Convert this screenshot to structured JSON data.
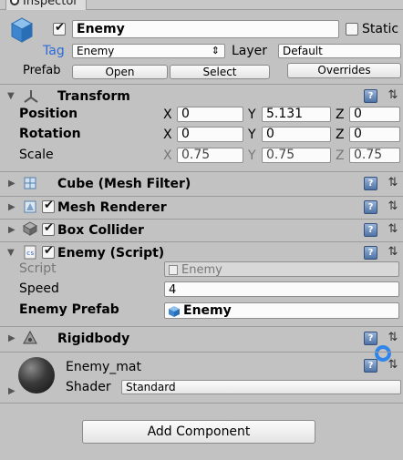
{
  "header": {
    "tab_label": "Inspector"
  },
  "gameobject": {
    "name": "Enemy",
    "static_label": "Static",
    "tag_label": "Tag",
    "tag_value": "Enemy",
    "layer_label": "Layer",
    "layer_value": "Default",
    "prefab_label": "Prefab",
    "open_label": "Open",
    "select_label": "Select",
    "overrides_label": "Overrides"
  },
  "transform": {
    "title": "Transform",
    "position_label": "Position",
    "rotation_label": "Rotation",
    "scale_label": "Scale",
    "x": "X",
    "y": "Y",
    "z": "Z",
    "position": [
      "0",
      "5.131",
      "0"
    ],
    "rotation": [
      "0",
      "0",
      "0"
    ],
    "scale": [
      "0.75",
      "0.75",
      "0.75"
    ]
  },
  "components": {
    "mesh_filter": "Cube (Mesh Filter)",
    "mesh_renderer": "Mesh Renderer",
    "box_collider": "Box Collider",
    "enemy_script": "Enemy (Script)",
    "rigidbody": "Rigidbody"
  },
  "script": {
    "script_label": "Script",
    "script_value": "Enemy",
    "speed_label": "Speed",
    "speed_value": "4",
    "prefab_label": "Enemy Prefab",
    "prefab_value": "Enemy"
  },
  "material": {
    "name": "Enemy_mat",
    "shader_label": "Shader",
    "shader_value": "Standard"
  },
  "footer": {
    "add_component_label": "Add Component"
  },
  "icons": {
    "help": "?",
    "settings": "⇅",
    "dropdown": "⇕"
  },
  "colors": {
    "tag_label": "#2c6bd6",
    "checkbox_blue": "#2a64c8"
  }
}
